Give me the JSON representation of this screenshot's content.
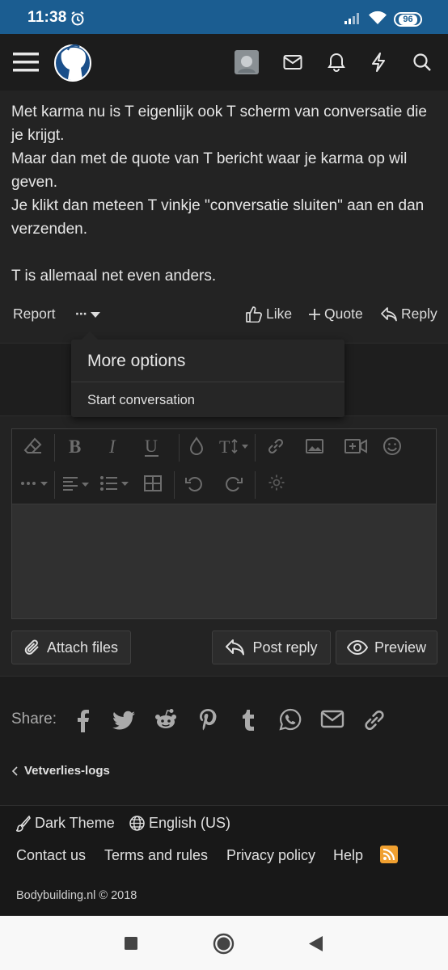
{
  "statusbar": {
    "time": "11:38",
    "battery": "96"
  },
  "post": {
    "paragraphs": [
      "Met karma nu is T eigenlijk ook T scherm van conversatie die je krijgt.\nMaar dan met de quote van T bericht waar je karma op wil geven.\nJe klikt dan meteen T vinkje \"conversatie sluiten\" aan en dan verzenden.",
      "T is allemaal net even anders."
    ]
  },
  "actions": {
    "report": "Report",
    "more": "···",
    "like": "Like",
    "quote": "Quote",
    "reply": "Reply"
  },
  "dropdown": {
    "title": "More options",
    "items": [
      "Start conversation"
    ]
  },
  "editor": {
    "attach": "Attach files",
    "post_reply": "Post reply",
    "preview": "Preview"
  },
  "share": {
    "label": "Share:",
    "icons": [
      "facebook-icon",
      "twitter-icon",
      "reddit-icon",
      "pinterest-icon",
      "tumblr-icon",
      "whatsapp-icon",
      "email-icon",
      "link-icon"
    ]
  },
  "breadcrumb": {
    "label": "Vetverlies-logs"
  },
  "footer": {
    "theme": "Dark Theme",
    "language": "English (US)",
    "links": [
      "Contact us",
      "Terms and rules",
      "Privacy policy",
      "Help"
    ],
    "copyright": "Bodybuilding.nl © 2018"
  },
  "colors": {
    "statusbar": "#1b5d91",
    "accent_rss": "#f0a030",
    "background": "#1a1a1a"
  }
}
